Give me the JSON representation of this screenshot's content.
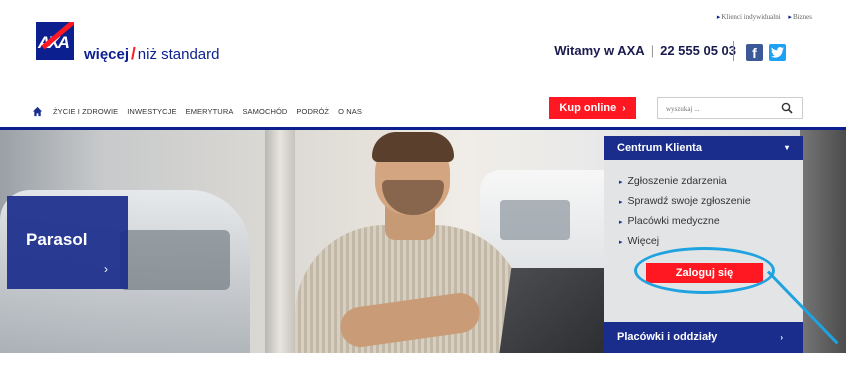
{
  "brand": {
    "logo_text": "AXA",
    "tagline_bold": "więcej",
    "tagline_slash": "/",
    "tagline_rest": "niż standard"
  },
  "top_links": [
    "Klienci indywidualni",
    "Biznes"
  ],
  "contact": {
    "welcome": "Witamy w AXA",
    "phone": "22 555 05 03",
    "social": [
      "facebook-icon",
      "twitter-icon"
    ]
  },
  "nav": {
    "items": [
      "ŻYCIE I ZDROWIE",
      "INWESTYCJE",
      "EMERYTURA",
      "SAMOCHÓD",
      "PODRÓŻ",
      "O NAS"
    ],
    "buy_online": "Kup online",
    "buy_chevron": "›",
    "search_placeholder": "wyszukaj ..."
  },
  "hero": {
    "title": "Parasol",
    "chevron": "›"
  },
  "client_center": {
    "title": "Centrum Klienta",
    "caret": "▾",
    "links": [
      "Zgłoszenie zdarzenia",
      "Sprawdź swoje zgłoszenie",
      "Placówki medyczne",
      "Więcej"
    ],
    "login_label": "Zaloguj się"
  },
  "branches": {
    "title": "Placówki i oddziały",
    "caret": "›"
  },
  "colors": {
    "axa_blue": "#1a2d8c",
    "axa_red": "#ff1721",
    "annotation_blue": "#1fa3e0"
  }
}
